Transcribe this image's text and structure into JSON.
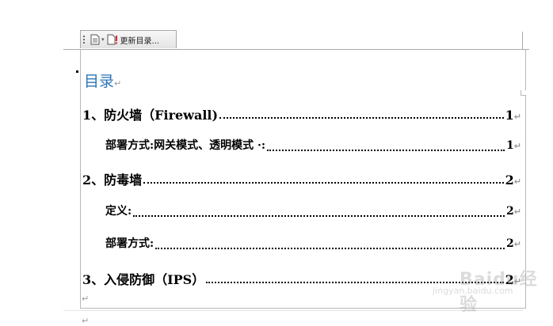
{
  "toolbar": {
    "update_label": "更新目录...",
    "dropdown_glyph": "▾"
  },
  "toc": {
    "title": "目录",
    "paragraph_mark": "↵",
    "tab_mark": "→",
    "entries": [
      {
        "text": "1、防火墙（Firewall)",
        "page": "1",
        "level": 1
      },
      {
        "text": "部署方式:网关模式、透明模式 ·:",
        "page": "1",
        "level": 2
      },
      {
        "text": "2、防毒墙",
        "page": "2",
        "level": 1
      },
      {
        "text": "定义:",
        "page": "2",
        "level": 2
      },
      {
        "text": "部署方式:",
        "page": "2",
        "level": 2
      },
      {
        "text": "3、入侵防御（IPS）",
        "page": "2",
        "level": 1
      }
    ]
  },
  "colors": {
    "toc_title": "#2e74b5",
    "frame_border": "#b8b8b8",
    "mark": "#9a9a9a"
  },
  "watermark": {
    "logo": "Baidu经验",
    "url": "jingyan.baidu.com"
  }
}
